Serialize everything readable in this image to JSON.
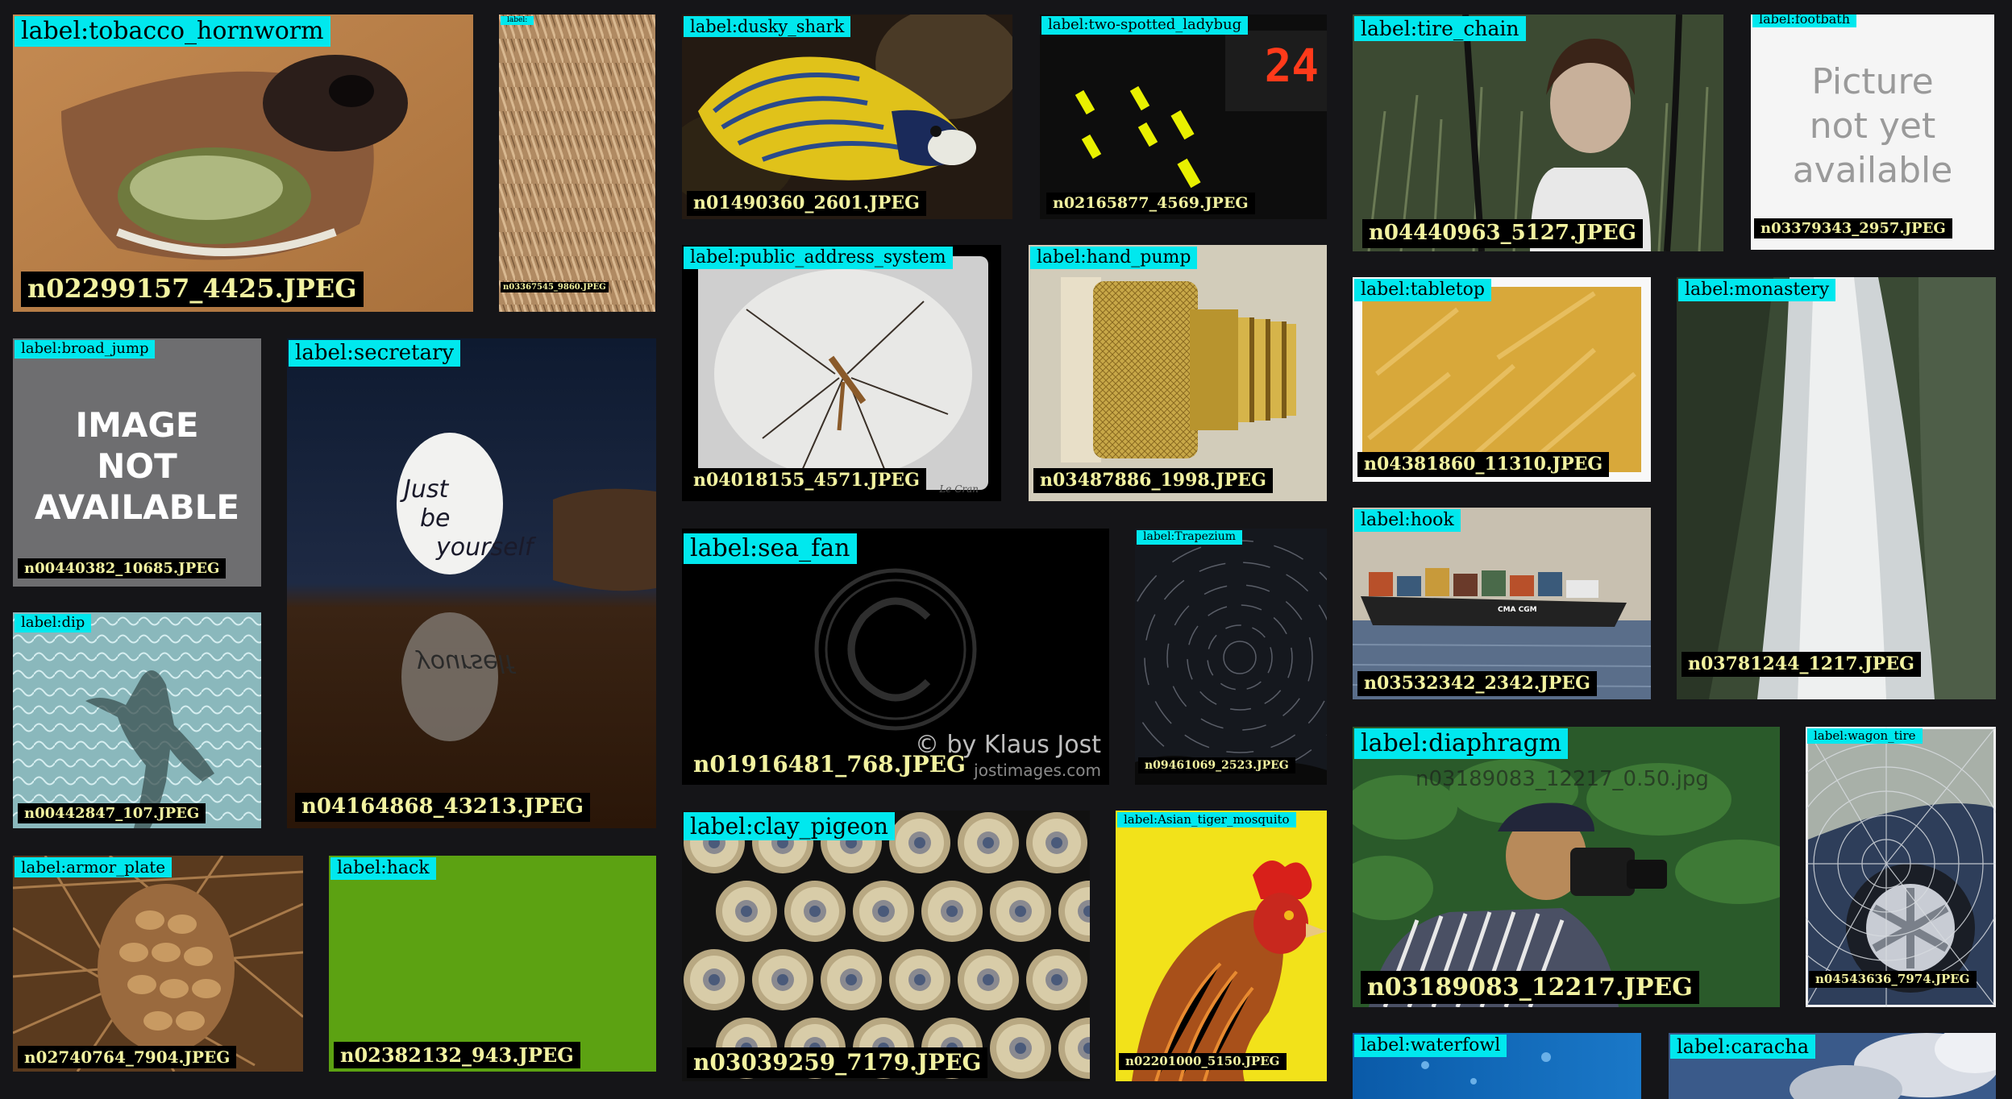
{
  "tiles": [
    {
      "id": "t1",
      "label": "label:tobacco_hornworm",
      "filename": "n02299157_4425.JPEG",
      "subject": "dog-muzzle"
    },
    {
      "id": "t2",
      "label": "label:",
      "filename": "n03367545_9860.JPEG",
      "subject": "rope-fibers"
    },
    {
      "id": "t3",
      "label": "label:dusky_shark",
      "filename": "n01490360_2601.JPEG",
      "subject": "angelfish"
    },
    {
      "id": "t4",
      "label": "label:two-spotted_ladybug",
      "filename": "n02165877_4569.JPEG",
      "subject": "display-lights",
      "display_number": "24"
    },
    {
      "id": "t5",
      "label": "label:tire_chain",
      "filename": "n04440963_5127.JPEG",
      "subject": "mannequin-on-swing"
    },
    {
      "id": "t6",
      "label": "label:footbath",
      "filename": "n03379343_2957.JPEG",
      "subject": "placeholder",
      "placeholder_text": [
        "Picture",
        "not yet",
        "available"
      ]
    },
    {
      "id": "t7",
      "label": "label:broad_jump",
      "filename": "n00440382_10685.JPEG",
      "subject": "placeholder",
      "placeholder_text": [
        "IMAGE",
        "NOT",
        "AVAILABLE"
      ]
    },
    {
      "id": "t8",
      "label": "label:secretary",
      "filename": "n04164868_43213.JPEG",
      "subject": "egg",
      "egg_text": [
        "Just",
        "be",
        "yourself"
      ],
      "reflection_text": "yourself"
    },
    {
      "id": "t9",
      "label": "label:public_address_system",
      "filename": "n04018155_4571.JPEG",
      "subject": "crane-fly",
      "signature": "Le Cran"
    },
    {
      "id": "t10",
      "label": "label:hand_pump",
      "filename": "n03487886_1998.JPEG",
      "subject": "brass-fitting"
    },
    {
      "id": "t11",
      "label": "label:tabletop",
      "filename": "n04381860_11310.JPEG",
      "subject": "wood-surface"
    },
    {
      "id": "t12",
      "label": "label:monastery",
      "filename": "n03781244_1217.JPEG",
      "subject": "waterfall"
    },
    {
      "id": "t13",
      "label": "label:sea_fan",
      "filename": "n01916481_768.JPEG",
      "subject": "copyright-placeholder",
      "watermark": "© by Klaus Jost",
      "watermark_url": "jostimages.com"
    },
    {
      "id": "t14",
      "label": "label:Trapezium",
      "filename": "n09461069_2523.JPEG",
      "subject": "star-trails"
    },
    {
      "id": "t15",
      "label": "label:hook",
      "filename": "n03532342_2342.JPEG",
      "subject": "container-ship",
      "ship_text": "CMA CGM"
    },
    {
      "id": "t16",
      "label": "label:dip",
      "filename": "n00442847_107.JPEG",
      "subject": "pool-shadow"
    },
    {
      "id": "t17",
      "label": "label:diaphragm",
      "filename": "n03189083_12217.JPEG",
      "subject": "photographer",
      "overlay_text": "n03189083_12217_0.50.jpg"
    },
    {
      "id": "t18",
      "label": "label:wagon_tire",
      "filename": "n04543636_7974.JPEG",
      "subject": "spiderweb-wheel"
    },
    {
      "id": "t19",
      "label": "label:armor_plate",
      "filename": "n02740764_7904.JPEG",
      "subject": "pinecone"
    },
    {
      "id": "t20",
      "label": "label:hack",
      "filename": "n02382132_943.JPEG",
      "subject": "green-field"
    },
    {
      "id": "t21",
      "label": "label:clay_pigeon",
      "filename": "n03039259_7179.JPEG",
      "subject": "shotgun-shells"
    },
    {
      "id": "t22",
      "label": "label:Asian_tiger_mosquito",
      "filename": "n02201000_5150.JPEG",
      "subject": "rooster"
    },
    {
      "id": "t23",
      "label": "label:waterfowl",
      "filename": "",
      "subject": "blue-water"
    },
    {
      "id": "t24",
      "label": "label:caracha",
      "filename": "",
      "subject": "clouds"
    }
  ]
}
